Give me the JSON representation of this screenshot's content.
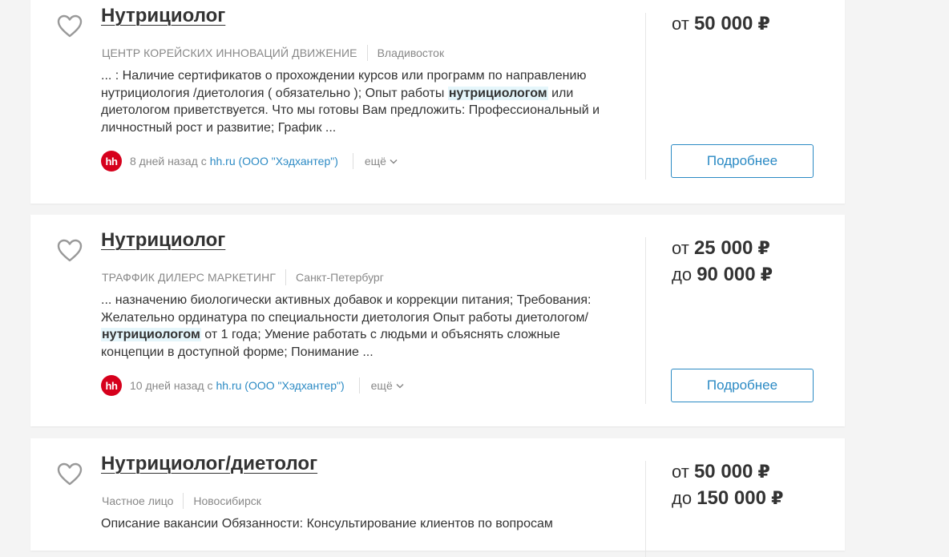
{
  "vacancies": [
    {
      "title": "Нутрициолог",
      "company": "ЦЕНТР КОРЕЙСКИХ ИННОВАЦИЙ ДВИЖЕНИЕ",
      "city": "Владивосток",
      "snippet_before": "... : Наличие сертификатов о прохождении курсов или программ по направлению нутрициология /диетология ( обязательно ); Опыт работы ",
      "snippet_highlight": "нутрициологом",
      "snippet_after": " или диетологом приветствуется. Что мы готовы Вам предложить: Профессиональный и личностный рост и развитие; График ...",
      "posted": "8 дней назад с",
      "source_link": "hh.ru (ООО \"Хэдхантер\")",
      "more_label": "ещё",
      "salary_from_prefix": "от",
      "salary_from": "50 000",
      "salary_to_prefix": "",
      "salary_to": "",
      "currency": "₽",
      "details_label": "Подробнее"
    },
    {
      "title": "Нутрициолог",
      "company": "ТРАФФИК ДИЛЕРС МАРКЕТИНГ",
      "city": "Санкт-Петербург",
      "snippet_before": "... назначению биологически активных добавок и коррекции питания; Требования: Желательно ординатура по специальности диетология Опыт работы диетологом/ ",
      "snippet_highlight": "нутрициологом",
      "snippet_after": " от 1 года; Умение работать с людьми и объяснять сложные концепции в доступной форме; Понимание ...",
      "posted": "10 дней назад с",
      "source_link": "hh.ru (ООО \"Хэдхантер\")",
      "more_label": "ещё",
      "salary_from_prefix": "от",
      "salary_from": "25 000",
      "salary_to_prefix": "до",
      "salary_to": "90 000",
      "currency": "₽",
      "details_label": "Подробнее"
    },
    {
      "title": "Нутрициолог/диетолог",
      "company": "Частное лицо",
      "city": "Новосибирск",
      "snippet_before": "Описание вакансии Обязанности: Консультирование клиентов по вопросам",
      "snippet_highlight": "",
      "snippet_after": "",
      "salary_from_prefix": "от",
      "salary_from": "50 000",
      "salary_to_prefix": "до",
      "salary_to": "150 000",
      "currency": "₽"
    }
  ],
  "icons": {
    "favorite": "heart-outline-icon",
    "source_logo": "hh-logo",
    "more": "chevron-down-icon"
  },
  "source_logo_text": "hh",
  "colors": {
    "link": "#2b8ac4",
    "highlight_bg": "#e5f6fb",
    "hh_red": "#d6001c",
    "heart": "#999999"
  }
}
